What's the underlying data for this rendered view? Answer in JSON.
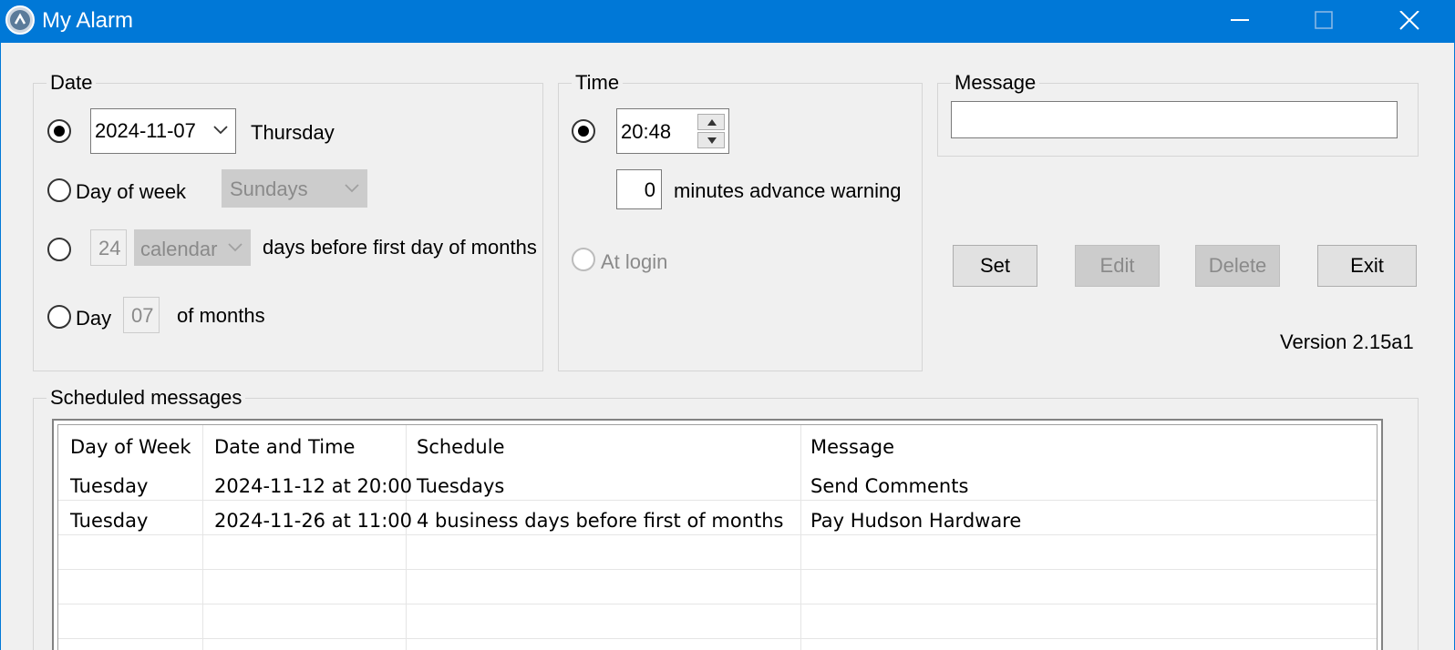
{
  "window": {
    "title": "My Alarm",
    "icon": "alarm-app-icon"
  },
  "date_group": {
    "legend": "Date",
    "date_value": "2024-11-07",
    "weekday": "Thursday",
    "day_of_week_label": "Day of week",
    "day_of_week_value": "Sundays",
    "days_before_value": "24",
    "days_before_type": "calendar",
    "days_before_label": "days before first day of months",
    "day_label": "Day",
    "day_value": "07",
    "of_months_label": "of months"
  },
  "time_group": {
    "legend": "Time",
    "time_value": "20:48",
    "advance_value": "0",
    "advance_label": "minutes advance warning",
    "at_login_label": "At login"
  },
  "message_group": {
    "legend": "Message",
    "message_value": ""
  },
  "buttons": {
    "set": "Set",
    "edit": "Edit",
    "delete": "Delete",
    "exit": "Exit"
  },
  "version": "Version 2.15a1",
  "scheduled": {
    "legend": "Scheduled messages",
    "columns": [
      "Day of Week",
      "Date and Time",
      "Schedule",
      "Message"
    ],
    "rows": [
      [
        "Tuesday",
        "2024-11-12 at 20:00",
        "Tuesdays",
        "Send Comments"
      ],
      [
        "Tuesday",
        "2024-11-26 at 11:00",
        "4 business days before first of months",
        "Pay Hudson Hardware"
      ]
    ]
  },
  "colors": {
    "titlebar": "#0078d7",
    "window_bg": "#f0f0f0",
    "disabled_bg": "#cccccc"
  }
}
